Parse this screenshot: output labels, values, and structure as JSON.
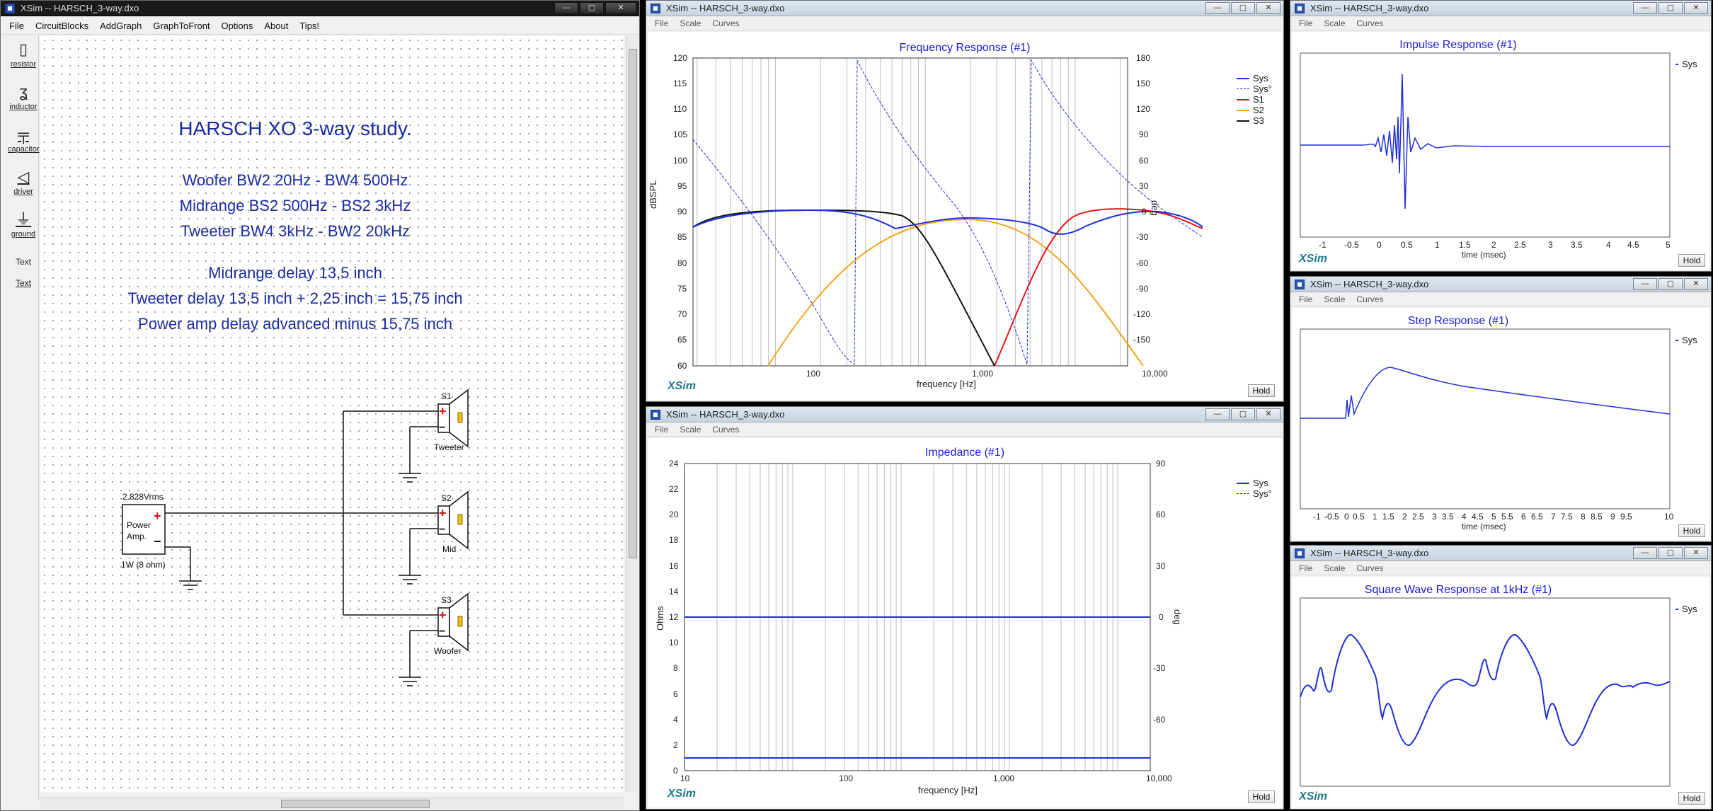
{
  "editor": {
    "title": "XSim -- HARSCH_3-way.dxo",
    "menu": [
      "File",
      "CircuitBlocks",
      "AddGraph",
      "GraphToFront",
      "Options",
      "About",
      "Tips!"
    ],
    "tools": [
      {
        "label": "resistor",
        "icon": "resistor-icon"
      },
      {
        "label": "inductor",
        "icon": "inductor-icon"
      },
      {
        "label": "capacitor",
        "icon": "capacitor-icon"
      },
      {
        "label": "driver",
        "icon": "driver-icon"
      },
      {
        "label": "ground",
        "icon": "ground-icon"
      },
      {
        "label": "Text",
        "icon": ""
      },
      {
        "label": "Text",
        "icon": ""
      }
    ],
    "notes": [
      "HARSCH XO 3-way study.",
      "Woofer BW2 20Hz - BW4 500Hz",
      "Midrange BS2 500Hz - BS2 3kHz",
      "Tweeter BW4 3kHz - BW2 20kHz",
      "Midrange delay 13,5 inch",
      "Tweeter delay 13,5 inch + 2,25 inch = 15,75 inch",
      "Power amp delay advanced minus 15,75 inch"
    ],
    "schematic": {
      "amp_voltage": "2.828Vrms",
      "amp_name_1": "Power",
      "amp_name_2": "Amp.",
      "amp_load": "1W (8 ohm)",
      "drivers": [
        {
          "id": "S1",
          "name": "Tweeter"
        },
        {
          "id": "S2",
          "name": "Mid"
        },
        {
          "id": "S3",
          "name": "Woofer"
        }
      ]
    }
  },
  "graphs": {
    "menu": [
      "File",
      "Scale",
      "Curves"
    ],
    "logo": "XSim",
    "hold": "Hold",
    "freq": {
      "title": "XSim -- HARSCH_3-way.dxo",
      "graph_title": "Frequency Response (#1)",
      "ylabel": "dBSPL",
      "y2label": "deg",
      "xlabel": "frequency [Hz]",
      "yticks": [
        "120",
        "115",
        "110",
        "105",
        "100",
        "95",
        "90",
        "85",
        "80",
        "75",
        "70",
        "65",
        "60"
      ],
      "y2ticks": [
        "180",
        "150",
        "120",
        "90",
        "60",
        "30",
        "0",
        "-30",
        "-60",
        "-90",
        "-120",
        "-150"
      ],
      "xticks": [
        "100",
        "1,000",
        "10,000"
      ],
      "legend": [
        "Sys",
        "Sys°",
        "S1",
        "S2",
        "S3"
      ]
    },
    "imp": {
      "title": "XSim -- HARSCH_3-way.dxo",
      "graph_title": "Impedance (#1)",
      "ylabel": "Ohms",
      "y2label": "deg",
      "xlabel": "frequency [Hz]",
      "yticks": [
        "24",
        "22",
        "20",
        "18",
        "16",
        "14",
        "12",
        "10",
        "8",
        "6",
        "4",
        "2",
        "0"
      ],
      "y2ticks": [
        "90",
        "60",
        "30",
        "0",
        "-30",
        "-60"
      ],
      "xticks": [
        "10",
        "100",
        "1,000",
        "10,000"
      ],
      "legend": [
        "Sys",
        "Sys°"
      ]
    },
    "impulse": {
      "title": "XSim -- HARSCH_3-way.dxo",
      "graph_title": "Impulse Response (#1)",
      "xlabel": "time (msec)",
      "xticks": [
        "-1",
        "-0.5",
        "0",
        "0.5",
        "1",
        "1.5",
        "2",
        "2.5",
        "3",
        "3.5",
        "4",
        "4.5",
        "5"
      ],
      "legend": [
        "Sys"
      ]
    },
    "step": {
      "title": "XSim -- HARSCH_3-way.dxo",
      "graph_title": "Step Response (#1)",
      "xlabel": "time (msec)",
      "xticks": [
        "-1",
        "-0.5",
        "0",
        "0.5",
        "1",
        "1.5",
        "2",
        "2.5",
        "3",
        "3.5",
        "4",
        "4.5",
        "5",
        "5.5",
        "6",
        "6.5",
        "7",
        "7.5",
        "8",
        "8.5",
        "9",
        "9.5",
        "10"
      ],
      "legend": [
        "Sys"
      ]
    },
    "square": {
      "title": "XSim -- HARSCH_3-way.dxo",
      "graph_title": "Square Wave Response at 1kHz (#1)",
      "legend": [
        "Sys"
      ]
    }
  },
  "colors": {
    "sys": "#1f2fd6",
    "s1": "#e8141a",
    "s2": "#f2a51a",
    "s3": "#111111",
    "grid": "#bdbdbd",
    "note": "#1a2ca0"
  }
}
